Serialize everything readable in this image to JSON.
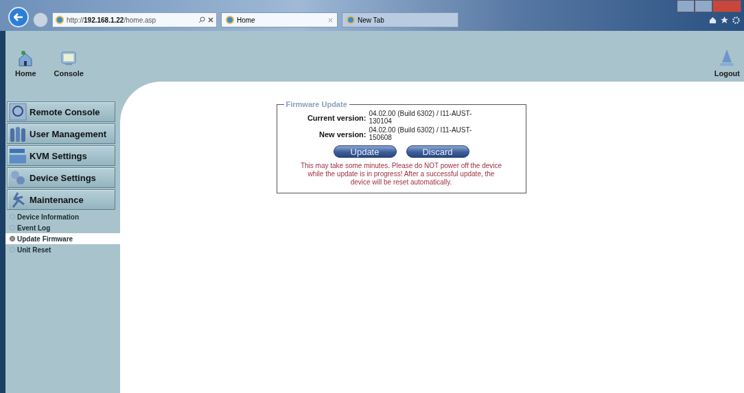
{
  "browser": {
    "address": "http://**192.168.1.22**/home.asp",
    "tabs": [
      {
        "label": "Home",
        "selected": true
      },
      {
        "label": "New Tab",
        "selected": false
      }
    ]
  },
  "toolbar": {
    "items": [
      {
        "label": "Home",
        "kind": "home"
      },
      {
        "label": "Console",
        "kind": "console"
      }
    ],
    "logout": "Logout"
  },
  "menu": [
    {
      "label": "Remote Console",
      "kind": "console"
    },
    {
      "label": "User Management",
      "kind": "users"
    },
    {
      "label": "KVM Settings",
      "kind": "kvm"
    },
    {
      "label": "Device Settings",
      "kind": "device"
    },
    {
      "label": "Maintenance",
      "kind": "maintenance"
    }
  ],
  "submenu": [
    {
      "label": "Device Information",
      "selected": false
    },
    {
      "label": "Event Log",
      "selected": false
    },
    {
      "label": "Update Firmware",
      "selected": true
    },
    {
      "label": "Unit Reset",
      "selected": false
    }
  ],
  "firmware": {
    "title": "Firmware Update",
    "rows": [
      {
        "label": "Current version:",
        "value": "04.02.00 (Build 6302) / I11-AUST-130104"
      },
      {
        "label": "New version:",
        "value": "04.02.00 (Build 6302) / I11-AUST-150608"
      }
    ],
    "buttons": [
      "Update",
      "Discard"
    ],
    "warning": "This may take some minutes. Please do NOT power off the device while the update is in progress! After a successful update, the device will be reset automatically."
  }
}
